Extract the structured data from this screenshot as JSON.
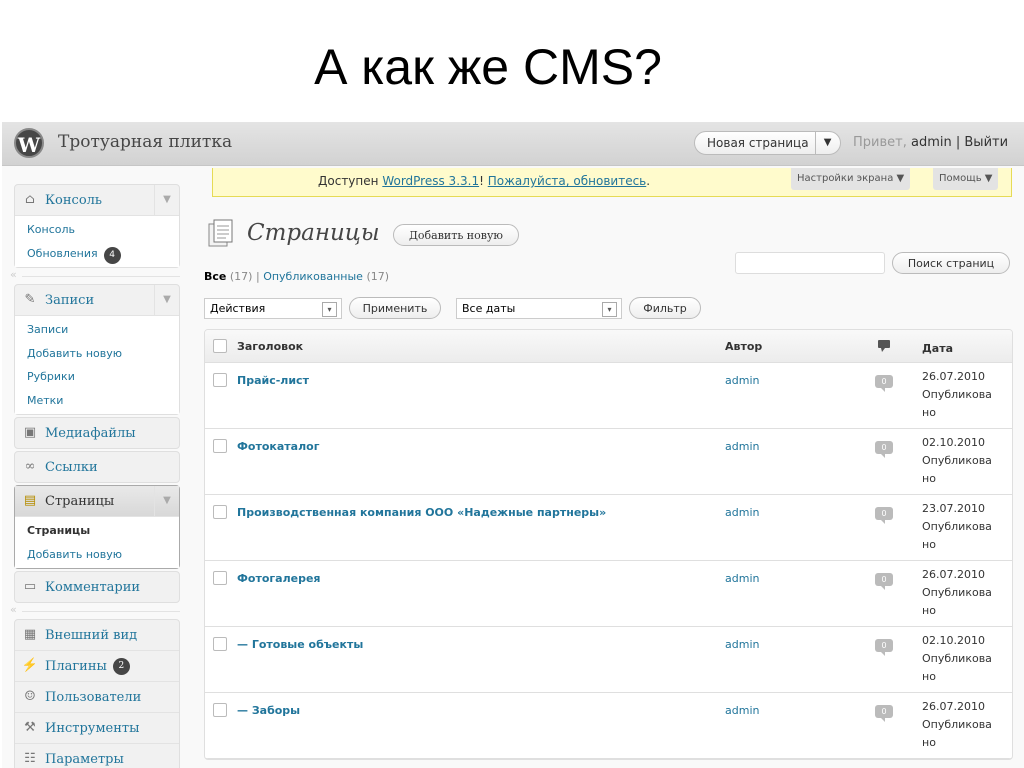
{
  "slide": {
    "title": "А как же CMS?"
  },
  "header": {
    "site_name": "Тротуарная плитка",
    "new_page_label": "Новая страница",
    "new_page_arrow": "▼",
    "greeting": "Привет,",
    "user": "admin",
    "separator": "|",
    "logout": "Выйти"
  },
  "notice": {
    "prefix": "Доступен",
    "link_version": "WordPress 3.3.1",
    "bang": "!",
    "link_update": "Пожалуйста, обновитесь",
    "suffix": ".",
    "screen_options": "Настройки экрана ▼",
    "help": "Помощь ▼"
  },
  "sidebar": {
    "console": {
      "label": "Консоль",
      "items": [
        "Консоль",
        "Обновления"
      ],
      "updates_count": "4"
    },
    "posts": {
      "label": "Записи",
      "items": [
        "Записи",
        "Добавить новую",
        "Рубрики",
        "Метки"
      ]
    },
    "media": "Медиафайлы",
    "links": "Ссылки",
    "pages": {
      "label": "Страницы",
      "items": [
        "Страницы",
        "Добавить новую"
      ]
    },
    "comments": "Комментарии",
    "appearance": "Внешний вид",
    "plugins": {
      "label": "Плагины",
      "count": "2"
    },
    "users": "Пользователи",
    "tools": "Инструменты",
    "settings": "Параметры",
    "toggle": "▼"
  },
  "main": {
    "title": "Страницы",
    "add_new": "Добавить новую",
    "filter_all": "Все",
    "filter_all_count": "(17)",
    "filter_sep": "|",
    "filter_published": "Опубликованные",
    "filter_published_count": "(17)",
    "search_button": "Поиск страниц",
    "bulk_actions": "Действия",
    "apply": "Применить",
    "all_dates": "Все даты",
    "filter": "Фильтр",
    "select_arrow": "▾"
  },
  "table": {
    "headers": {
      "title": "Заголовок",
      "author": "Автор",
      "date": "Дата"
    },
    "rows": [
      {
        "title": "Прайс-лист",
        "author": "admin",
        "comments": "0",
        "date": "26.07.2010",
        "status": "Опубликова но"
      },
      {
        "title": "Фотокаталог",
        "author": "admin",
        "comments": "0",
        "date": "02.10.2010",
        "status": "Опубликова но"
      },
      {
        "title": "Производственная компания ООО «Надежные партнеры»",
        "author": "admin",
        "comments": "0",
        "date": "23.07.2010",
        "status": "Опубликова но"
      },
      {
        "title": "Фотогалерея",
        "author": "admin",
        "comments": "0",
        "date": "26.07.2010",
        "status": "Опубликова но"
      },
      {
        "title": "— Готовые объекты",
        "author": "admin",
        "comments": "0",
        "date": "02.10.2010",
        "status": "Опубликова но"
      },
      {
        "title": "— Заборы",
        "author": "admin",
        "comments": "0",
        "date": "26.07.2010",
        "status": "Опубликова но"
      }
    ]
  },
  "icons": {
    "wp_logo": "wordpress-logo-icon",
    "dashboard": "house-icon",
    "posts": "pin-icon",
    "media": "camera-icon",
    "links": "chain-icon",
    "pages": "page-icon",
    "comments": "speech-bubble-icon",
    "appearance": "window-icon",
    "plugins": "plug-icon",
    "users": "users-icon",
    "tools": "tools-icon",
    "settings": "settings-icon",
    "comment_header": "comment-bubble-icon"
  },
  "colors": {
    "link": "#21759b",
    "notice_bg": "#fffbcc",
    "header_bg": "#dcdcdc",
    "badge": "#464646"
  }
}
